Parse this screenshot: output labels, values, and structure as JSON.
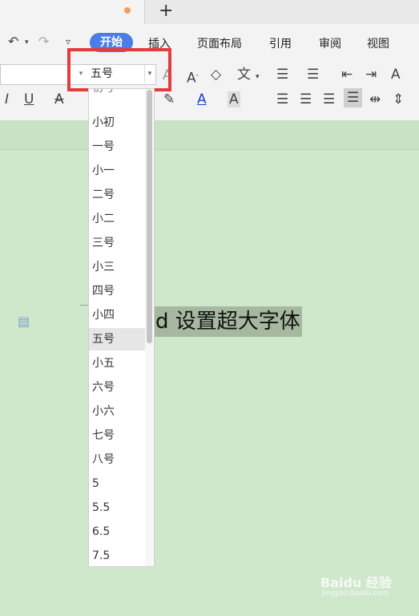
{
  "tabs": {
    "new_tab": "+"
  },
  "menu": {
    "items": [
      "开始",
      "插入",
      "页面布局",
      "引用",
      "审阅",
      "视图"
    ],
    "undo_icon": "undo-icon",
    "redo_icon": "redo-icon",
    "customize_icon": "customize-icon"
  },
  "font_size": {
    "value": "五号"
  },
  "dropdown": {
    "partial_top": "初号",
    "options": [
      "小初",
      "一号",
      "小一",
      "二号",
      "小二",
      "三号",
      "小三",
      "四号",
      "小四",
      "五号",
      "小五",
      "六号",
      "小六",
      "七号",
      "八号",
      "5",
      "5.5",
      "6.5",
      "7.5"
    ],
    "selected": "五号"
  },
  "document": {
    "text": "d 设置超大字体"
  },
  "watermark": {
    "main": "Baidu 经验",
    "sub": "jingyan.baidu.com"
  },
  "colors": {
    "accent": "#4a7de6",
    "highlight_box": "#e43c3c",
    "page": "#cfe8cc"
  }
}
